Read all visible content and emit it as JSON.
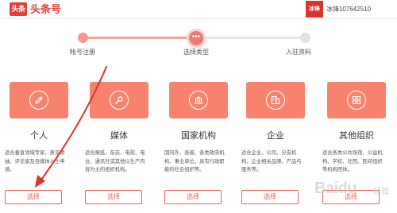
{
  "header": {
    "logo_badge": "头条",
    "logo_text": "头条号",
    "avatar_text": "冰锋",
    "user_name": "冰锋107642510"
  },
  "progress": {
    "current_dot": "•••",
    "steps": [
      "帐号注册",
      "选择类型",
      "入驻资料"
    ]
  },
  "cards": [
    {
      "title": "个人",
      "desc": "适合垂直领域专家、意见领袖、评论家及自媒体人士申请。",
      "button": "选择"
    },
    {
      "title": "媒体",
      "desc": "适合报纸、杂志、电视、电台、通讯社或其他以生产内容为主的组织机构。",
      "button": "选择"
    },
    {
      "title": "国家机构",
      "desc": "国内外、各级、各类政府机构、事业单位、具有行政职能的社会组织等。",
      "button": "选择"
    },
    {
      "title": "企业",
      "desc": "适合企业、公司、分支机构、企业相关品牌、产品与服务等。",
      "button": "选择"
    },
    {
      "title": "其他组织",
      "desc": "适合各类公共场馆、公益机构、学校、社团、民间组织等机构团体。",
      "button": "选择"
    }
  ],
  "watermark": {
    "text": "Baidu",
    "sub": "经验"
  },
  "colors": {
    "brand": "#e53f39",
    "card_tile": "#f7836f",
    "button_border": "#e8625a",
    "annotation_arrow": "#e0302a"
  }
}
